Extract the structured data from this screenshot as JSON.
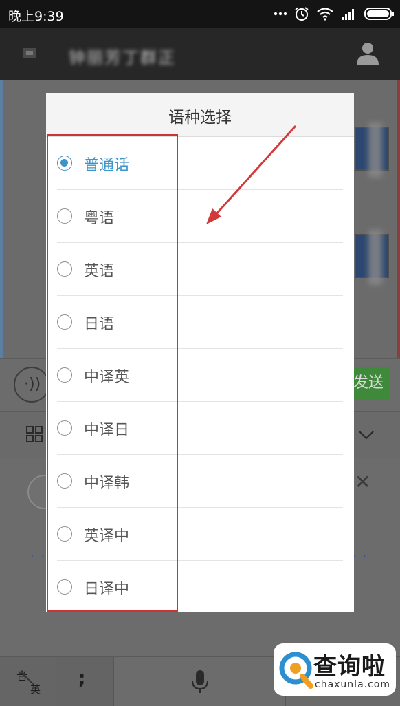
{
  "status_bar": {
    "time": "晚上9:39",
    "icons": [
      "more-dots-icon",
      "alarm-icon",
      "wifi-icon",
      "signal-icon",
      "battery-icon"
    ]
  },
  "title_bar": {
    "title": "钟丽芳丁群正",
    "icons": [
      "back-icon",
      "contact-icon"
    ]
  },
  "chat_input": {
    "send_label": "发送"
  },
  "dialog": {
    "title": "语种选择",
    "selected": "普通话",
    "options": [
      {
        "label": "普通话",
        "checked": true
      },
      {
        "label": "粤语",
        "checked": false
      },
      {
        "label": "英语",
        "checked": false
      },
      {
        "label": "日语",
        "checked": false
      },
      {
        "label": "中译英",
        "checked": false
      },
      {
        "label": "中译日",
        "checked": false
      },
      {
        "label": "中译韩",
        "checked": false
      },
      {
        "label": "英译中",
        "checked": false
      },
      {
        "label": "日译中",
        "checked": false
      }
    ]
  },
  "keyboard": {
    "lang_top": "音",
    "lang_bottom": "英",
    "semicolon": ";"
  },
  "watermark": {
    "text": "查询啦",
    "sub": "chaxunla.com"
  },
  "colors": {
    "accent": "#3d94c9",
    "highlight_box": "#cc3333",
    "send_button": "#3f8a3a"
  }
}
